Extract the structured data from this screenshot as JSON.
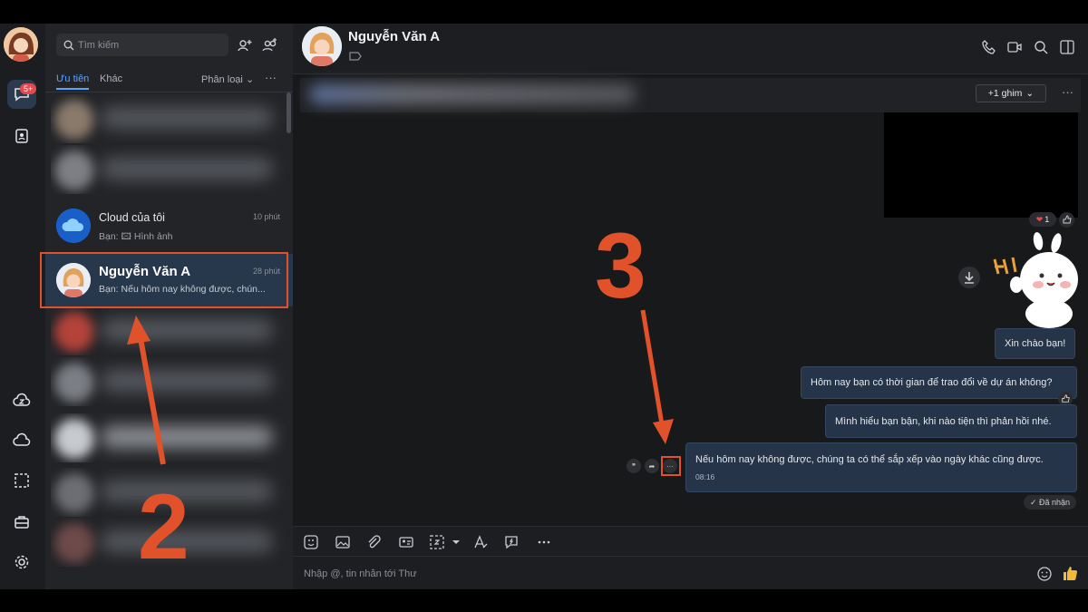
{
  "sidebar": {
    "chat_badge": "5+",
    "icons": [
      "avatar",
      "chat-bubble-icon",
      "contacts-icon",
      "zcloud-icon",
      "cloud-icon",
      "screenshot-icon",
      "toolbox-icon",
      "settings-icon"
    ]
  },
  "conversation_list": {
    "search_placeholder": "Tìm kiếm",
    "tabs": [
      {
        "label": "Ưu tiên",
        "active": true
      },
      {
        "label": "Khác",
        "active": false
      }
    ],
    "filter_label": "Phân loại",
    "more": "···",
    "items": [
      {
        "name": "Cloud của tôi",
        "time": "10 phút",
        "preview_prefix": "Bạn:",
        "preview": "Hình ảnh"
      },
      {
        "name": "Nguyễn Văn A",
        "time": "28 phút",
        "preview": "Bạn: Nếu hôm nay không được, chún...",
        "selected": true
      }
    ]
  },
  "chat": {
    "contact_name": "Nguyễn Văn A",
    "pin_button": "+1 ghim",
    "more": "···",
    "reaction_count": "1",
    "messages": [
      {
        "text": "Xin chào bạn!"
      },
      {
        "text": "Hôm nay bạn có thời gian để trao đổi về dự án không?"
      },
      {
        "text": "Mình hiểu bạn bận, khi nào tiện thì phản hồi nhé."
      },
      {
        "text": "Nếu hôm nay không được, chúng ta có thể sắp xếp vào ngày khác cũng được.",
        "time": "08:16"
      }
    ],
    "status": "Đã nhận",
    "composer_placeholder": "Nhập @, tin nhắn tới Thư"
  },
  "annotations": {
    "step_2": "2",
    "step_3": "3"
  },
  "colors": {
    "annotation": "#e2522a",
    "accent": "#5aa3ff",
    "bubble": "#253449"
  }
}
